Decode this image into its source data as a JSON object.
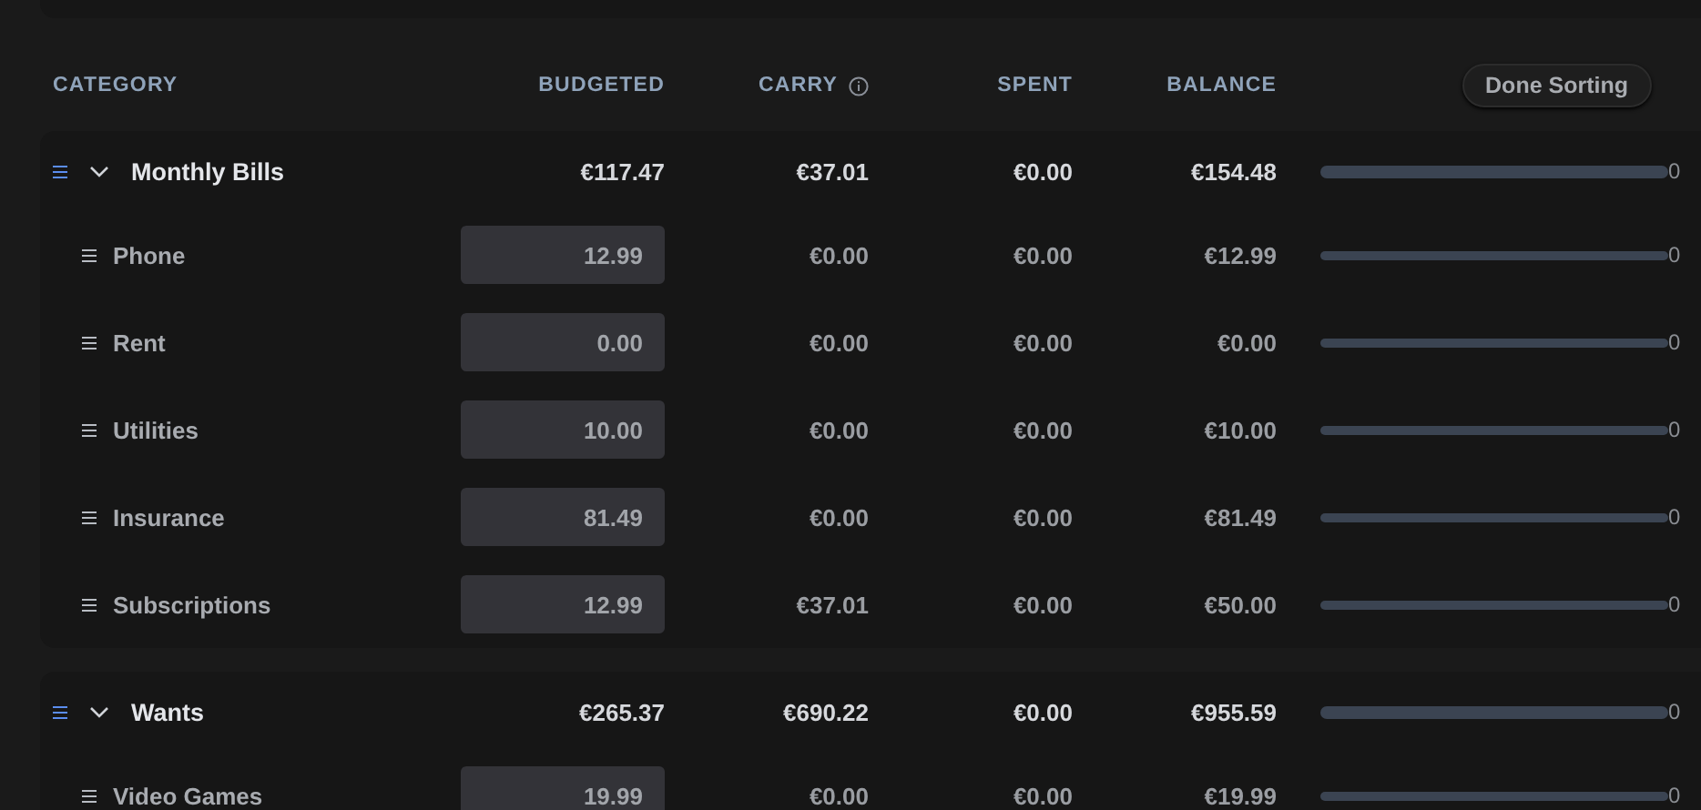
{
  "columns": [
    "CATEGORY",
    "BUDGETED",
    "CARRY",
    "SPENT",
    "BALANCE"
  ],
  "done_sorting_button": "Done Sorting",
  "groups": [
    {
      "name": "Monthly Bills",
      "expanded": true,
      "budgeted": "€117.47",
      "carry": "€37.01",
      "spent": "€0.00",
      "balance": "€154.48",
      "level": 0,
      "percent": "0",
      "categories": [
        {
          "name": "Phone",
          "budgeted": "12.99",
          "carry": "€0.00",
          "spent": "€0.00",
          "balance": "€12.99",
          "level": 0,
          "percent": "0"
        },
        {
          "name": "Rent",
          "budgeted": "0.00",
          "carry": "€0.00",
          "spent": "€0.00",
          "balance": "€0.00",
          "level": 0,
          "percent": "0"
        },
        {
          "name": "Utilities",
          "budgeted": "10.00",
          "carry": "€0.00",
          "spent": "€0.00",
          "balance": "€10.00",
          "level": 0,
          "percent": "0"
        },
        {
          "name": "Insurance",
          "budgeted": "81.49",
          "carry": "€0.00",
          "spent": "€0.00",
          "balance": "€81.49",
          "level": 0,
          "percent": "0"
        },
        {
          "name": "Subscriptions",
          "budgeted": "12.99",
          "carry": "€37.01",
          "spent": "€0.00",
          "balance": "€50.00",
          "level": 0,
          "percent": "0"
        }
      ]
    },
    {
      "name": "Wants",
      "expanded": true,
      "budgeted": "€265.37",
      "carry": "€690.22",
      "spent": "€0.00",
      "balance": "€955.59",
      "level": 0,
      "percent": "0",
      "categories": [
        {
          "name": "Video Games",
          "budgeted": "19.99",
          "carry": "€0.00",
          "spent": "€0.00",
          "balance": "€19.99",
          "level": 0,
          "percent": "0"
        }
      ]
    }
  ]
}
